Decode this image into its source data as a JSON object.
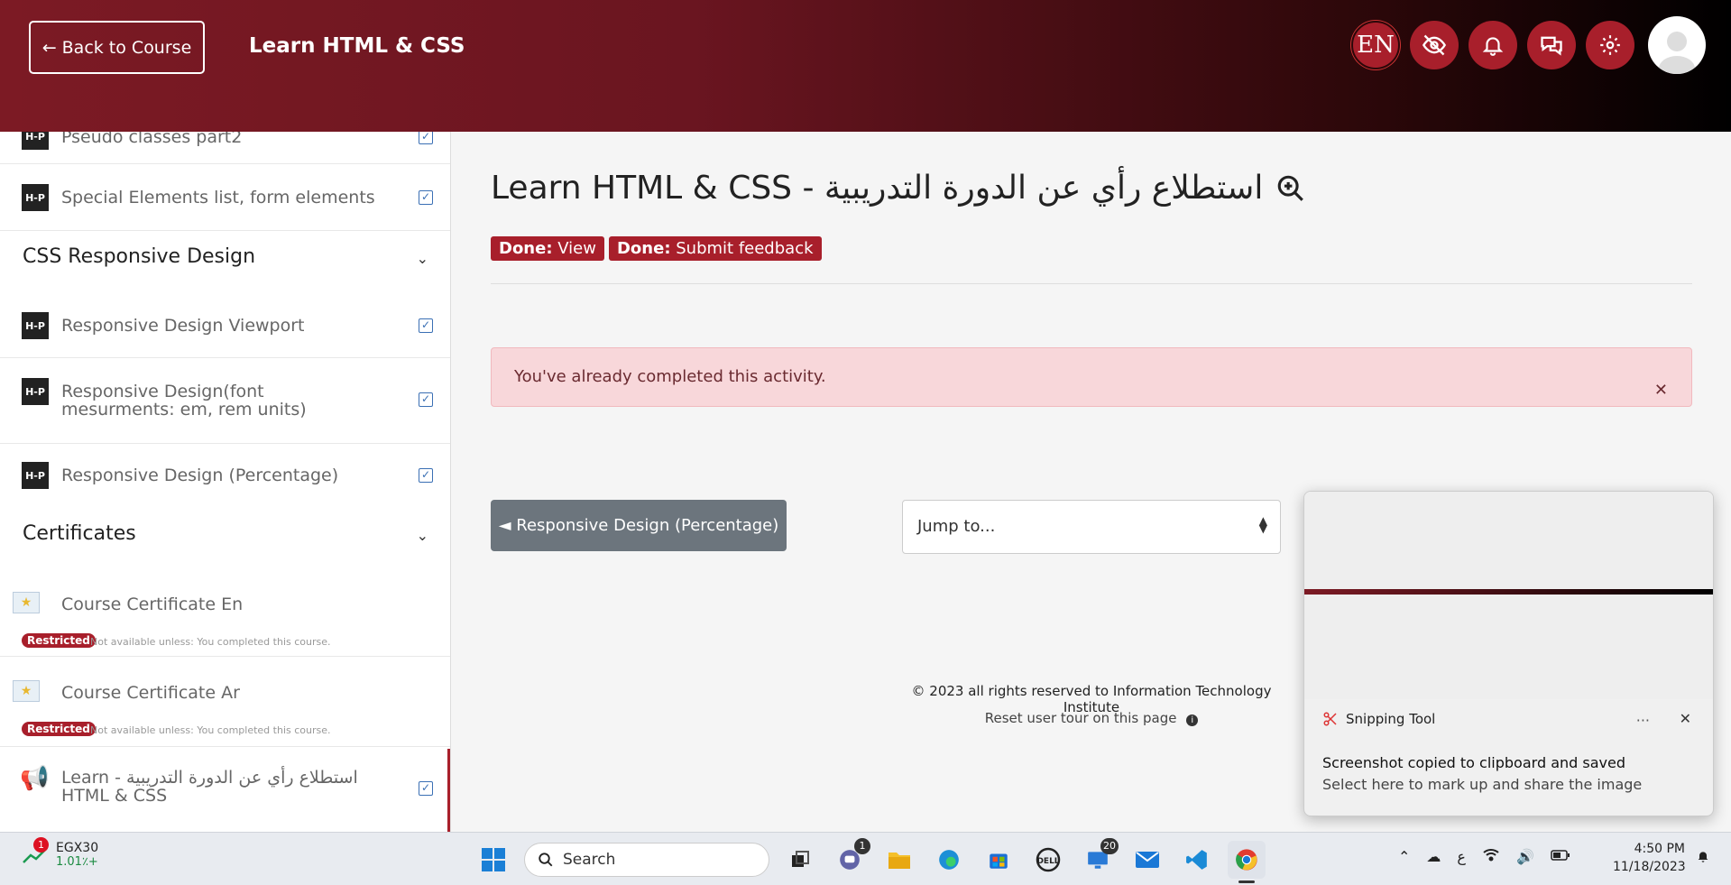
{
  "header": {
    "back_label": "Back to Course",
    "course_title": "Learn HTML & CSS",
    "lang_label": "EN"
  },
  "sidebar": {
    "items": [
      {
        "label": "Pseudo classes part2"
      },
      {
        "label": "Special Elements list, form elements"
      },
      {
        "label": "Responsive Design Viewport"
      },
      {
        "label": "Responsive Design(font mesurments: em, rem units)"
      },
      {
        "label": "Responsive Design (Percentage)"
      }
    ],
    "sections": [
      {
        "label": "CSS Responsive Design"
      },
      {
        "label": "Certificates"
      }
    ],
    "certificates": [
      {
        "label": "Course Certificate En",
        "badge": "Restricted",
        "note": "Not available unless: You completed this course."
      },
      {
        "label": "Course Certificate Ar",
        "badge": "Restricted",
        "note": "Not available unless: You completed this course."
      }
    ],
    "feedback_item": {
      "label": "استطلاع رأي عن الدورة التدريبية - Learn HTML & CSS"
    },
    "hp_icon_text": "H-P"
  },
  "main": {
    "title": "استطلاع رأي عن الدورة التدريبية - Learn HTML & CSS",
    "badges": [
      {
        "prefix": "Done:",
        "text": "View"
      },
      {
        "prefix": "Done:",
        "text": "Submit feedback"
      }
    ],
    "alert_text": "You've already completed this activity.",
    "prev_button": "◄ Responsive Design (Percentage)",
    "jump_placeholder": "Jump to...",
    "footer_copyright": "© 2023 all rights reserved to Information Technology Institute",
    "footer_tour": "Reset user tour on this page"
  },
  "toast": {
    "app_name": "Snipping Tool",
    "line1": "Screenshot copied to clipboard and saved",
    "line2": "Select here to mark up and share the image"
  },
  "taskbar": {
    "stock_name": "EGX30",
    "stock_change": "1.01٪+",
    "stock_badge": "1",
    "search_label": "Search",
    "chat_badge": "1",
    "app_badge": "20",
    "ime": "ع",
    "time": "4:50 PM",
    "date": "11/18/2023"
  },
  "colors": {
    "brand": "#a81f2b",
    "header_start": "#7c1a24",
    "alert_bg": "#f8d7da",
    "prev_btn": "#6c757d"
  }
}
